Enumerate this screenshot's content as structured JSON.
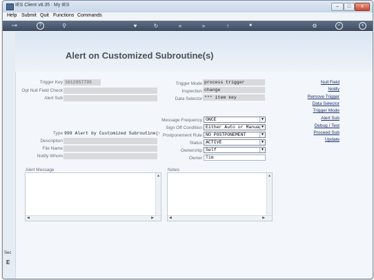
{
  "window": {
    "title": "IES Client v8.35 : My IES",
    "app_icon": "ies-app-icon",
    "controls": {
      "minimize": "–",
      "maximize": "□",
      "close": "x"
    }
  },
  "menubar": {
    "items": [
      "Help",
      "Submit",
      "Quit",
      "Functions",
      "Commands"
    ]
  },
  "toolbar": {
    "icons": [
      "key-icon",
      "help-icon",
      "search-icon",
      "heart-icon",
      "refresh-icon",
      "rewind-icon",
      "fast-forward-icon",
      "upload-icon",
      "stop-icon",
      "settings-icon",
      "check-icon",
      "close-icon"
    ],
    "glyphs": {
      "key": "⊸",
      "help": "?",
      "search": "⚲",
      "heart": "♥",
      "refresh": "↻",
      "rewind": "«",
      "forward": "»",
      "upload": "↑",
      "stop": "■",
      "settings": "⚙",
      "check": "✓",
      "close": "x"
    }
  },
  "page": {
    "title": "Alert on Customized Subroutine(s)"
  },
  "left_strip": {
    "label": "Sec",
    "letter": "E"
  },
  "form": {
    "trigger_key": {
      "label": "Trigger Key",
      "value": "1612957795"
    },
    "opt_null_field_check": {
      "label": "Opt Null Field Check",
      "value": ""
    },
    "alert_sub": {
      "label": "Alert Sub",
      "value": ""
    },
    "trigger_mode": {
      "label": "Trigger Mode",
      "value": "process trigger"
    },
    "inspection": {
      "label": "Inspection",
      "value": "change"
    },
    "data_selector": {
      "label": "Data Selector",
      "value": "*** item key"
    },
    "message_frequency": {
      "label": "Message Frequency",
      "value": "ONCE"
    },
    "sign_off_condition": {
      "label": "Sign Off Condition",
      "value": "Either Auto or Manual"
    },
    "postponement_rule": {
      "label": "Postponement Rule",
      "value": "NO POSTPONEMENT"
    },
    "status": {
      "label": "Status",
      "value": "ACTIVE"
    },
    "ownership": {
      "label": "Ownership",
      "value": "Self"
    },
    "owner": {
      "label": "Owner",
      "value": "Tim"
    },
    "type": {
      "label": "Type",
      "value": "999 Alert by Customized Subroutine(s)"
    },
    "description": {
      "label": "Description",
      "value": ""
    },
    "file_name": {
      "label": "File Name",
      "value": ""
    },
    "notify_whom": {
      "label": "Notify Whom",
      "value": ""
    }
  },
  "links": [
    "Null Field",
    "Notify",
    "Remove Trigger",
    "Data Selector",
    "Trigger Mode",
    "Alert Sub",
    "Debug / Test",
    "Proceed Sub",
    "Update"
  ],
  "alert_message": {
    "label": "Alert Message",
    "value": ""
  },
  "notes": {
    "label": "Notes",
    "value": ""
  },
  "colors": {
    "toolbar": "#4d5c70",
    "banner": "#e3ebf5",
    "link": "#1a2f6b",
    "field_readonly": "#d8d9db"
  }
}
